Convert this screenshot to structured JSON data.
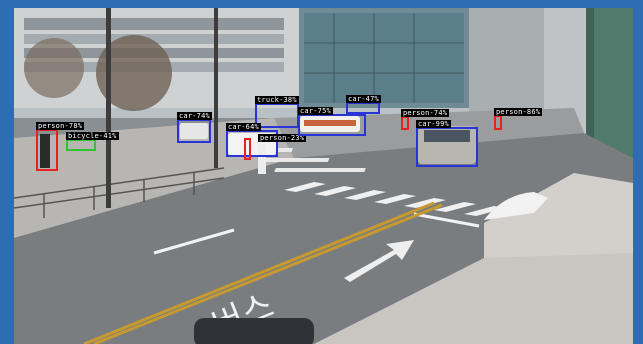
{
  "colors": {
    "frame": "#2e6db1",
    "person_box": "#e8211c",
    "car_box": "#2a33d6",
    "truck_box": "#2a33d6",
    "bicycle_box": "#2ec42e"
  },
  "detections": [
    {
      "id": "d1",
      "class": "person",
      "label": "person-78%",
      "color": "#e8211c"
    },
    {
      "id": "d2",
      "class": "bicycle",
      "label": "bicycle-41%",
      "color": "#2ec42e"
    },
    {
      "id": "d3",
      "class": "car",
      "label": "car-74%",
      "color": "#2a33d6"
    },
    {
      "id": "d4",
      "class": "truck",
      "label": "truck-38%",
      "color": "#2a33d6"
    },
    {
      "id": "d5",
      "class": "car",
      "label": "car-64%",
      "color": "#2a33d6"
    },
    {
      "id": "d6",
      "class": "person",
      "label": "person-23%",
      "color": "#e8211c"
    },
    {
      "id": "d7",
      "class": "car",
      "label": "car-75%",
      "color": "#2a33d6"
    },
    {
      "id": "d8",
      "class": "car",
      "label": "car-47%",
      "color": "#2a33d6"
    },
    {
      "id": "d9",
      "class": "person",
      "label": "person-74%",
      "color": "#e8211c"
    },
    {
      "id": "d10",
      "class": "car",
      "label": "car-99%",
      "color": "#2a33d6"
    },
    {
      "id": "d11",
      "class": "person",
      "label": "person-86%",
      "color": "#e8211c"
    }
  ],
  "road_marking_text": "버스"
}
